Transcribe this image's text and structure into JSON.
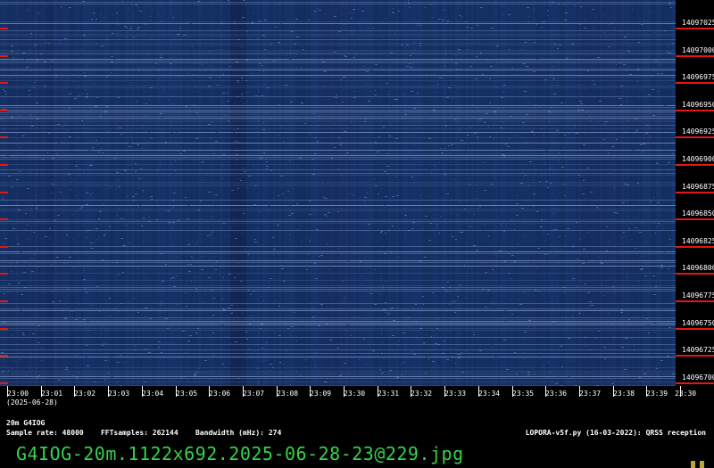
{
  "frequency_labels": [
    "14097025",
    "14097000",
    "14096975",
    "14096950",
    "14096925",
    "14096900",
    "14096875",
    "14096850",
    "14096825",
    "14096800",
    "14096775",
    "14096750",
    "14096725",
    "14096700"
  ],
  "time_labels": [
    "23:00",
    "23:01",
    "23:02",
    "23:03",
    "23:04",
    "23:05",
    "23:06",
    "23:07",
    "23:08",
    "23:09",
    "23:30",
    "23:31",
    "23:32",
    "23:33",
    "23:34",
    "23:35",
    "23:36",
    "23:37",
    "23:38",
    "23:39",
    "23:30"
  ],
  "date_label": "(2025-06-28)",
  "station_line": "20m G4IOG",
  "sample_info": {
    "sample_rate": "Sample rate: 48000",
    "fft_samples": "FFTsamples: 262144",
    "bandwidth": "Bandwidth (mHz): 274"
  },
  "software_label": "LOPORA-v5f.py (16-03-2022): QRSS reception",
  "filename": "G4IOG-20m.1122x692.2025-06-28-23@229.jpg",
  "colors": {
    "waterfall_bg": "#17336a",
    "tick_red": "#e01818",
    "filename_green": "#35d24a"
  }
}
